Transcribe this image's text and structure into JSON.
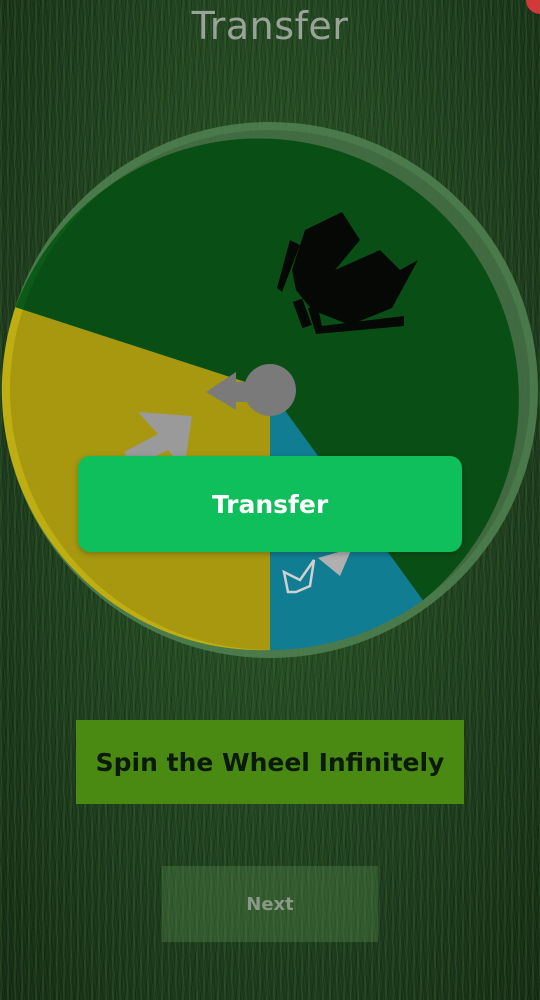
{
  "header": {
    "title": "Transfer"
  },
  "wheel": {
    "segments": [
      {
        "color": "#0b5a18",
        "icon": "goalkeeper-dive-icon"
      },
      {
        "color": "#bfae12",
        "icon": "arrow-icon"
      },
      {
        "color": "#138fa8",
        "icon": "bow-tie-icon"
      }
    ],
    "rim_color": "#5f8f5f",
    "pointer_color": "#7a7a7a"
  },
  "result": {
    "label": "Transfer"
  },
  "controls": {
    "spin_label": "Spin the Wheel Infinitely",
    "next_label": "Next"
  },
  "colors": {
    "result_button": "#0fbf5c",
    "spin_button": "#4a8a12",
    "accent_red": "#d23a3a"
  }
}
